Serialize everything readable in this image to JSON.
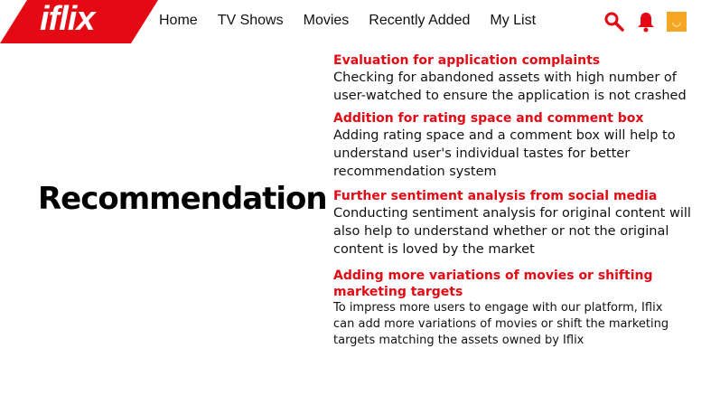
{
  "brand": {
    "logo": "iflix",
    "accent": "#e50914"
  },
  "nav": [
    "Home",
    "TV Shows",
    "Movies",
    "Recently Added",
    "My List"
  ],
  "icons": [
    "search-icon",
    "bell-icon",
    "avatar"
  ],
  "page_title": "Recommendation",
  "items": [
    {
      "heading": "Evaluation for application complaints",
      "body": "Checking for abandoned assets with high number of user-watched to ensure the application is not crashed"
    },
    {
      "heading": "Addition for rating space and comment box",
      "body": "Adding rating space and a comment box will help to understand user's individual tastes for better recommendation system"
    },
    {
      "heading": "Further sentiment analysis from social media",
      "body": "Conducting sentiment analysis for original content will also help to understand whether or not the original content is loved by the market"
    },
    {
      "heading": "Adding more variations of movies or shifting marketing targets",
      "body": "To impress more users to engage with our platform, Iflix can add more variations of movies or shift the marketing targets matching the assets owned by Iflix"
    }
  ]
}
